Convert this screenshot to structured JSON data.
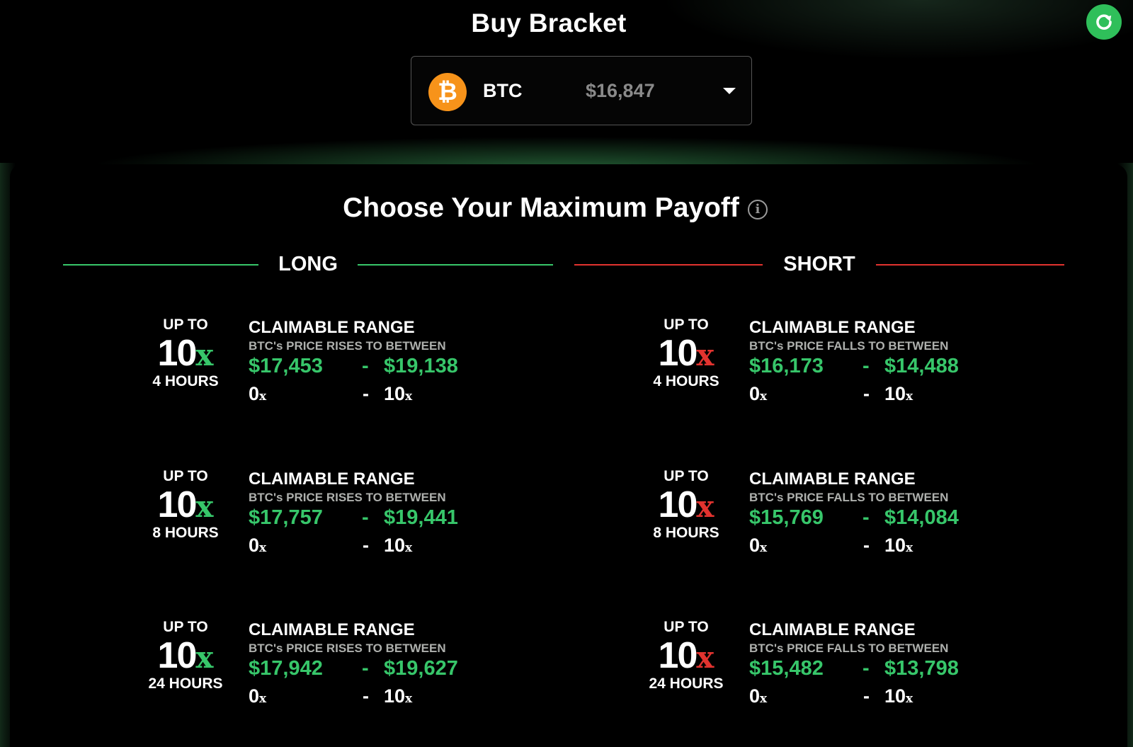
{
  "header": {
    "title": "Buy Bracket",
    "refresh_icon": "refresh-icon"
  },
  "asset_selector": {
    "icon": "bitcoin-icon",
    "symbol": "BTC",
    "price": "$16,847",
    "caret_icon": "caret-down-icon"
  },
  "payoff": {
    "title": "Choose Your Maximum Payoff",
    "info_icon": "info-icon",
    "long_label": "LONG",
    "short_label": "SHORT",
    "colors": {
      "long": "#37c66a",
      "short": "#e2332f",
      "price": "#37c66a"
    },
    "long": [
      {
        "up_to": "UP TO",
        "multiplier": "10",
        "x": "x",
        "duration": "4 HOURS",
        "title": "CLAIMABLE RANGE",
        "subtitle": "BTC's PRICE RISES TO BETWEEN",
        "low_price": "$17,453",
        "high_price": "$19,138",
        "low_mult": "0",
        "high_mult": "10",
        "sep": "-"
      },
      {
        "up_to": "UP TO",
        "multiplier": "10",
        "x": "x",
        "duration": "8 HOURS",
        "title": "CLAIMABLE RANGE",
        "subtitle": "BTC's PRICE RISES TO BETWEEN",
        "low_price": "$17,757",
        "high_price": "$19,441",
        "low_mult": "0",
        "high_mult": "10",
        "sep": "-"
      },
      {
        "up_to": "UP TO",
        "multiplier": "10",
        "x": "x",
        "duration": "24 HOURS",
        "title": "CLAIMABLE RANGE",
        "subtitle": "BTC's PRICE RISES TO BETWEEN",
        "low_price": "$17,942",
        "high_price": "$19,627",
        "low_mult": "0",
        "high_mult": "10",
        "sep": "-"
      }
    ],
    "short": [
      {
        "up_to": "UP TO",
        "multiplier": "10",
        "x": "x",
        "duration": "4 HOURS",
        "title": "CLAIMABLE RANGE",
        "subtitle": "BTC's PRICE FALLS TO BETWEEN",
        "low_price": "$16,173",
        "high_price": "$14,488",
        "low_mult": "0",
        "high_mult": "10",
        "sep": "-"
      },
      {
        "up_to": "UP TO",
        "multiplier": "10",
        "x": "x",
        "duration": "8 HOURS",
        "title": "CLAIMABLE RANGE",
        "subtitle": "BTC's PRICE FALLS TO BETWEEN",
        "low_price": "$15,769",
        "high_price": "$14,084",
        "low_mult": "0",
        "high_mult": "10",
        "sep": "-"
      },
      {
        "up_to": "UP TO",
        "multiplier": "10",
        "x": "x",
        "duration": "24 HOURS",
        "title": "CLAIMABLE RANGE",
        "subtitle": "BTC's PRICE FALLS TO BETWEEN",
        "low_price": "$15,482",
        "high_price": "$13,798",
        "low_mult": "0",
        "high_mult": "10",
        "sep": "-"
      }
    ]
  }
}
